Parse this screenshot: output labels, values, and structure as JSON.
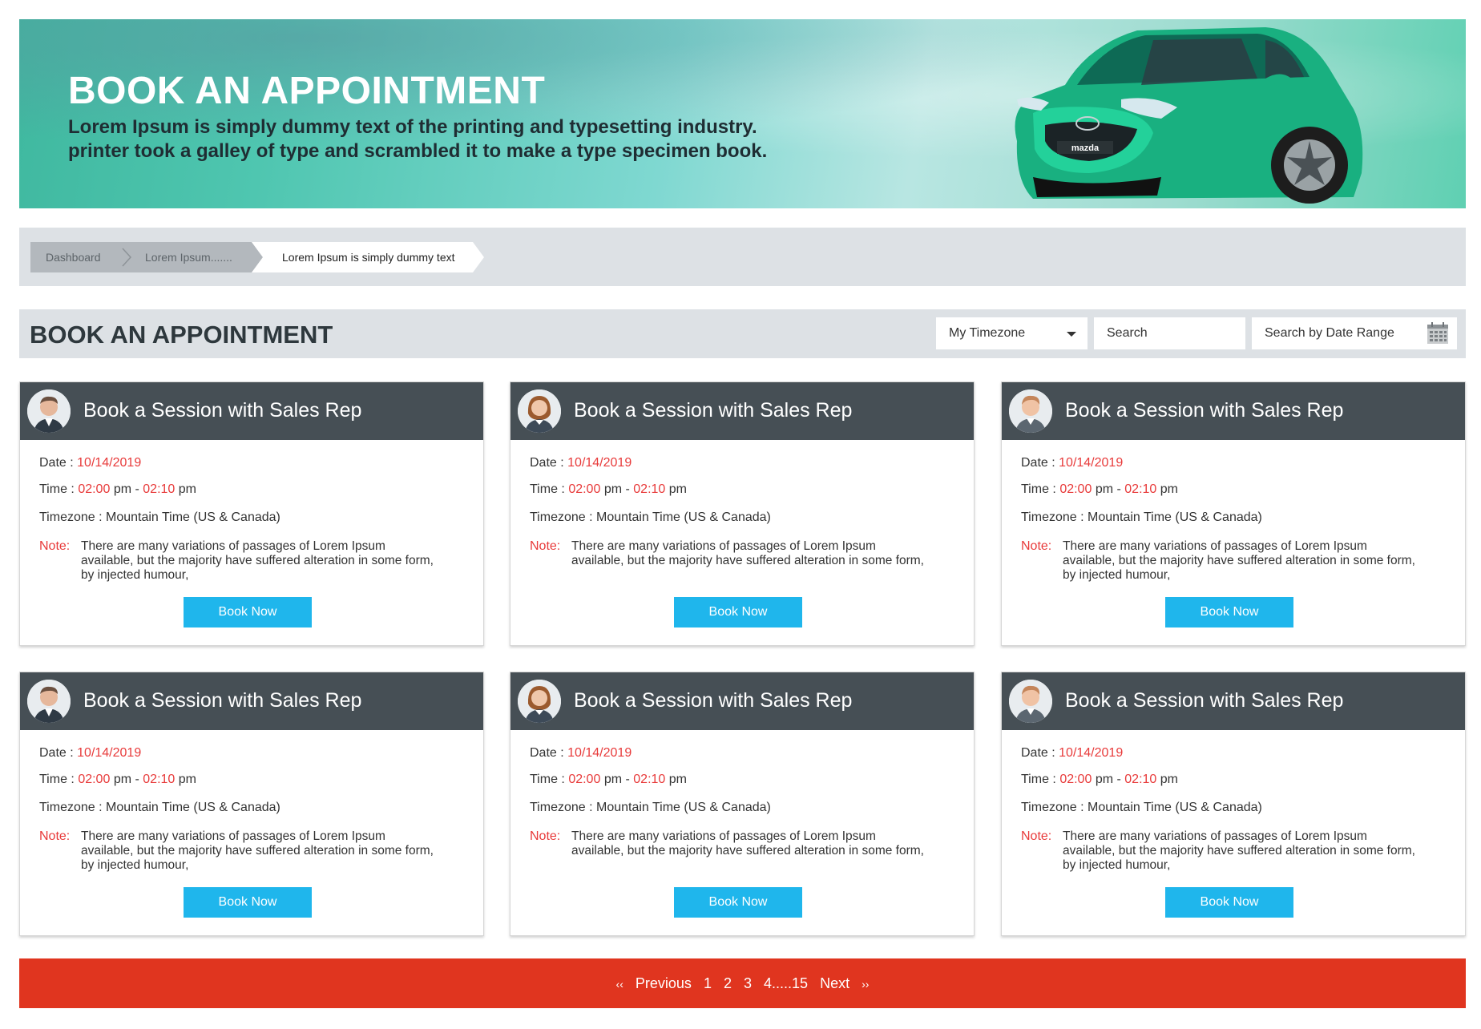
{
  "hero": {
    "title": "BOOK AN APPOINTMENT",
    "line1": "Lorem Ipsum is simply dummy text of the printing and typesetting industry.",
    "line2": "printer took a galley of type and scrambled it to make a type specimen book.",
    "image": "green-suv-car-image",
    "car_brand_plate": "mazda"
  },
  "breadcrumb": {
    "items": [
      "Dashboard",
      "Lorem Ipsum.......",
      "Lorem Ipsum is simply dummy text"
    ]
  },
  "section": {
    "title": "BOOK AN APPOINTMENT",
    "timezone_select": "My Timezone",
    "search_placeholder": "Search",
    "date_range_placeholder": "Search by Date Range",
    "calendar_icon": "calendar-icon"
  },
  "cards": [
    {
      "title": "Book a Session with Sales Rep",
      "avatar": "male-rep-avatar-1",
      "date_label": "Date :",
      "date": "10/14/2019",
      "time_label": "Time :",
      "time_start": "02:00",
      "time_end": "02:10",
      "ampm": "pm",
      "dash": "-",
      "timezone": "Timezone : Mountain Time (US & Canada)",
      "note_label": "Note:",
      "note": "There are many variations of passages of Lorem Ipsum available, but the majority have suffered alteration in some form, by injected humour,",
      "button": "Book Now"
    },
    {
      "title": "Book a Session with Sales Rep",
      "avatar": "female-rep-avatar",
      "date_label": "Date :",
      "date": "10/14/2019",
      "time_label": "Time :",
      "time_start": "02:00",
      "time_end": "02:10",
      "ampm": "pm",
      "dash": "-",
      "timezone": "Timezone : Mountain Time (US & Canada)",
      "note_label": "Note:",
      "note": "There are many variations of passages of Lorem Ipsum available, but the majority have suffered alteration in some form,",
      "button": "Book Now"
    },
    {
      "title": "Book a Session with Sales Rep",
      "avatar": "male-rep-avatar-2",
      "date_label": "Date :",
      "date": "10/14/2019",
      "time_label": "Time :",
      "time_start": "02:00",
      "time_end": "02:10",
      "ampm": "pm",
      "dash": "-",
      "timezone": "Timezone : Mountain Time (US & Canada)",
      "note_label": "Note:",
      "note": "There are many variations of passages of Lorem Ipsum available, but the majority have suffered alteration in some form, by injected humour,",
      "button": "Book Now"
    },
    {
      "title": "Book a Session with Sales Rep",
      "avatar": "male-rep-avatar-1",
      "date_label": "Date :",
      "date": "10/14/2019",
      "time_label": "Time :",
      "time_start": "02:00",
      "time_end": "02:10",
      "ampm": "pm",
      "dash": "-",
      "timezone": "Timezone : Mountain Time (US & Canada)",
      "note_label": "Note:",
      "note": "There are many variations of passages of Lorem Ipsum available, but the majority have suffered alteration in some form, by injected humour,",
      "button": "Book Now"
    },
    {
      "title": "Book a Session with Sales Rep",
      "avatar": "female-rep-avatar",
      "date_label": "Date :",
      "date": "10/14/2019",
      "time_label": "Time :",
      "time_start": "02:00",
      "time_end": "02:10",
      "ampm": "pm",
      "dash": "-",
      "timezone": "Timezone : Mountain Time (US & Canada)",
      "note_label": "Note:",
      "note": "There are many variations of passages of Lorem Ipsum available, but the majority have suffered alteration in some form,",
      "button": "Book Now"
    },
    {
      "title": "Book a Session with Sales Rep",
      "avatar": "male-rep-avatar-2",
      "date_label": "Date :",
      "date": "10/14/2019",
      "time_label": "Time :",
      "time_start": "02:00",
      "time_end": "02:10",
      "ampm": "pm",
      "dash": "-",
      "timezone": "Timezone : Mountain Time (US & Canada)",
      "note_label": "Note:",
      "note": "There are many variations of passages of Lorem Ipsum available, but the majority have suffered alteration in some form, by injected humour,",
      "button": "Book Now"
    }
  ],
  "pagination": {
    "first": "‹‹",
    "previous": "Previous",
    "pages": [
      "1",
      "2",
      "3",
      "4.....15"
    ],
    "next": "Next",
    "last": "››"
  },
  "colors": {
    "accent_blue": "#1fb6ec",
    "accent_red": "#e83a3a",
    "pager_red": "#e0351f",
    "card_header": "#464f55",
    "bar_grey": "#dde1e5"
  }
}
